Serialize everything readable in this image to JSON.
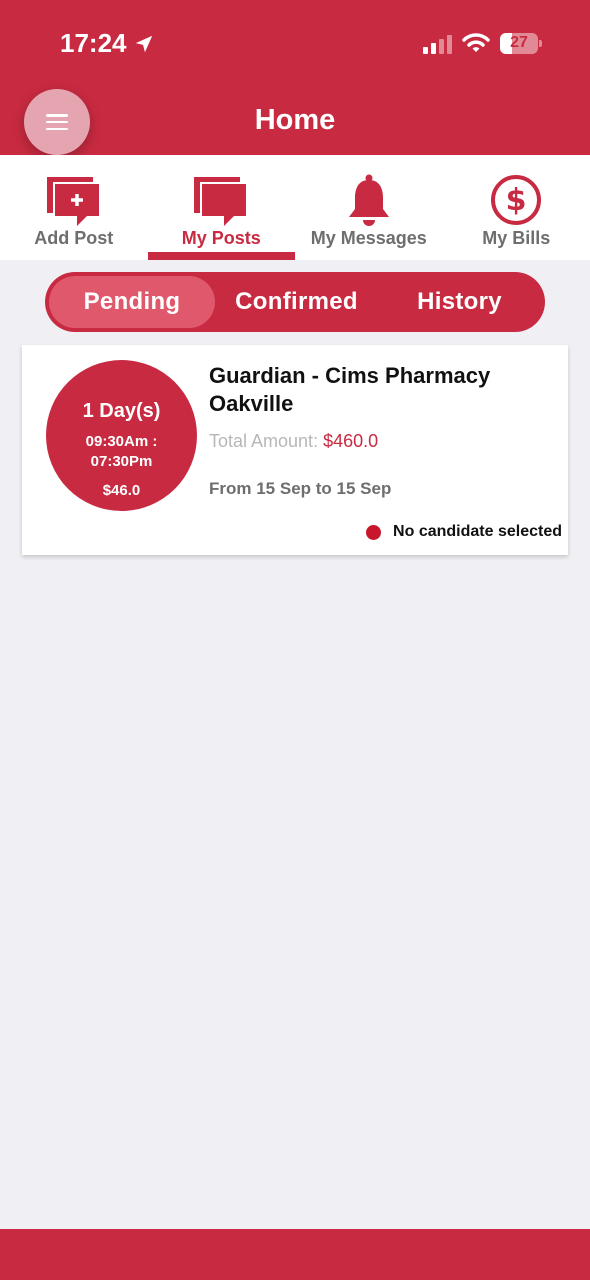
{
  "status_bar": {
    "time": "17:24",
    "battery": "27"
  },
  "header": {
    "title": "Home"
  },
  "tabs": [
    {
      "label": "Add Post",
      "icon": "add-post-icon"
    },
    {
      "label": "My Posts",
      "icon": "posts-icon",
      "active": true
    },
    {
      "label": "My Messages",
      "icon": "bell-icon"
    },
    {
      "label": "My Bills",
      "icon": "dollar-circle-icon"
    }
  ],
  "segments": {
    "pending": "Pending",
    "confirmed": "Confirmed",
    "history": "History",
    "active": "Pending"
  },
  "posts": [
    {
      "days": "1 Day(s)",
      "time_range": "09:30Am : 07:30Pm",
      "time_start": "09:30Am :",
      "time_end": "07:30Pm",
      "rate": "$46.0",
      "name": "Guardian - Cims Pharmacy Oakville",
      "total_label": "Total Amount:",
      "total_value": "$460.0",
      "dates": "From 15 Sep to 15 Sep",
      "status": "No candidate selected"
    }
  ],
  "colors": {
    "brand": "#c82a41",
    "segment_active": "#e0586b",
    "status_dot": "#c8172d",
    "background": "#f0eff4"
  }
}
